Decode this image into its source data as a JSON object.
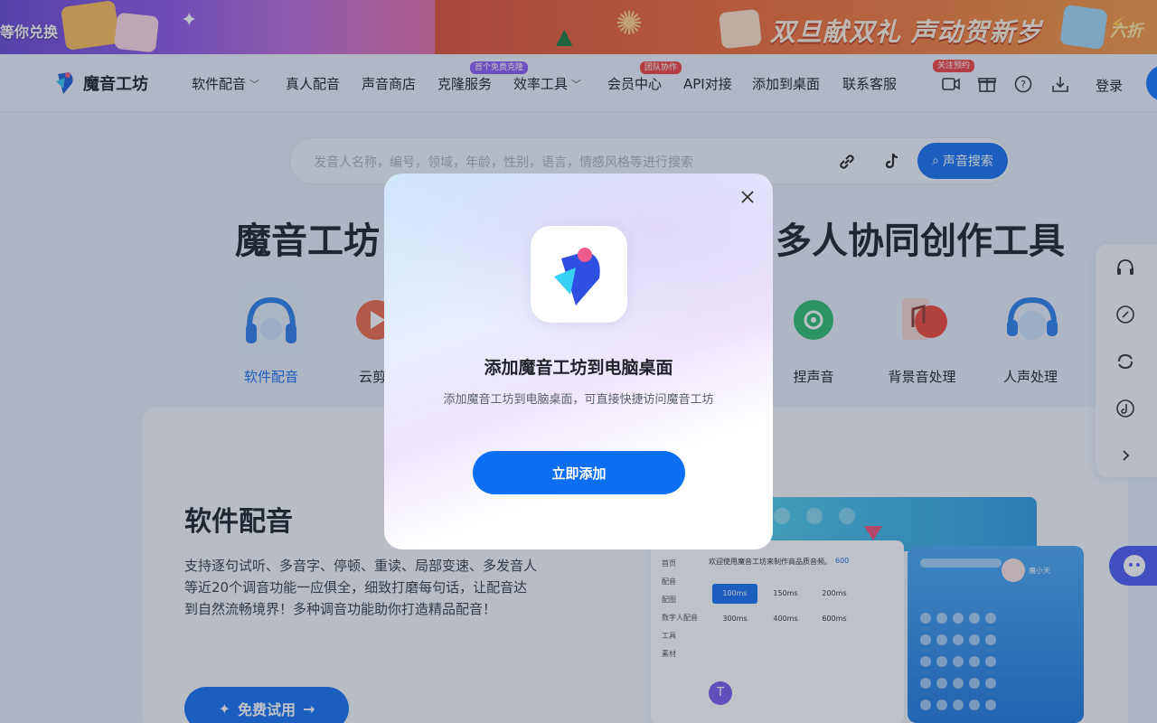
{
  "banner": {
    "left_text": "等你兑换",
    "title": "双旦献双礼 声动贺新岁",
    "right_text": "六折"
  },
  "nav": {
    "logo_text": "魔音工坊",
    "items": [
      {
        "label": "软件配音",
        "dropdown": true
      },
      {
        "label": "真人配音"
      },
      {
        "label": "声音商店"
      },
      {
        "label": "克隆服务",
        "badge": "首个免费克隆",
        "badge_color": "#8b5cf6"
      },
      {
        "label": "效率工具",
        "dropdown": true
      },
      {
        "label": "会员中心",
        "badge": "团队协作",
        "badge_color": "#ef4444"
      },
      {
        "label": "API对接"
      },
      {
        "label": "添加到桌面"
      },
      {
        "label": "联系客服"
      }
    ],
    "follow_badge": "关注预约",
    "icons": [
      "video-icon",
      "gift-icon",
      "help-icon",
      "download-icon"
    ],
    "login_label": "登录"
  },
  "search": {
    "placeholder": "发音人名称，编号，领域，年龄，性别，语言，情感风格等进行搜索",
    "button_label": "声音搜索"
  },
  "hero": {
    "title_left": "魔音工坊",
    "title_right": "多人协同创作工具"
  },
  "categories": [
    {
      "label": "软件配音",
      "active": true,
      "icon": "headphones-icon"
    },
    {
      "label": "云剪",
      "icon": "play-icon"
    },
    {
      "label": "捏声音",
      "icon": "vinyl-icon"
    },
    {
      "label": "背景音处理",
      "icon": "music-icon"
    },
    {
      "label": "人声处理",
      "icon": "voice-icon"
    }
  ],
  "section": {
    "title": "软件配音",
    "description": "支持逐句试听、多音字、停顿、重读、局部变速、多发音人等近20个调音功能一应俱全，细致打磨每句话，让配音达到自然流畅境界！多种调音功能助你打造精品配音！",
    "trial_label": "免费试用"
  },
  "mockup": {
    "welcome": "欢迎使用魔音工坊来制作商品质音频。",
    "count": "600",
    "durations": [
      "100ms",
      "150ms",
      "200ms",
      "300ms",
      "400ms",
      "600ms"
    ],
    "user_name": "魔小天",
    "side_items": [
      "首页",
      "配音",
      "配图",
      "数字人配音",
      "工具",
      "素材"
    ]
  },
  "float_panel": {
    "icons": [
      "support-icon",
      "link-icon",
      "refresh-icon",
      "tiktok-icon",
      "chevron-right-icon"
    ]
  },
  "modal": {
    "title": "添加魔音工坊到电脑桌面",
    "description": "添加魔音工坊到电脑桌面，可直接快捷访问魔音工坊",
    "button_label": "立即添加"
  },
  "colors": {
    "primary": "#1672f3",
    "modal_button": "#0b6ef3",
    "active_category": "#1672f3"
  }
}
